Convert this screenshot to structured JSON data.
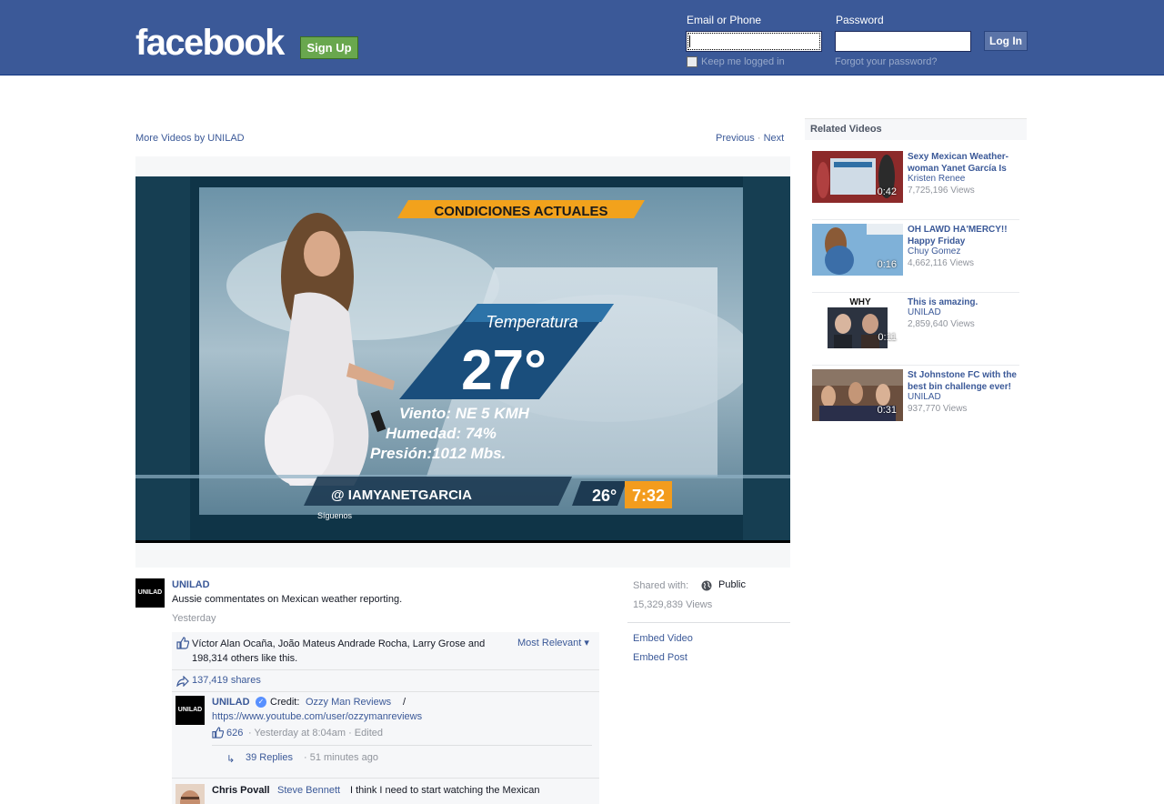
{
  "header": {
    "logo": "facebook",
    "signup_label": "Sign Up",
    "email_label": "Email or Phone",
    "password_label": "Password",
    "login_label": "Log In",
    "keep_logged_in": "Keep me logged in",
    "forgot_password": "Forgot your password?"
  },
  "nav": {
    "more_videos": "More Videos by UNILAD",
    "previous": "Previous",
    "separator": " · ",
    "next": "Next"
  },
  "video": {
    "banner": "CONDICIONES ACTUALES",
    "temp_label": "Temperatura",
    "temp_value": "27°",
    "wind": "Viento: NE 5 KMH",
    "humidity": "Humedad: 74%",
    "pressure": "Presión:1012 Mbs.",
    "handle": "@ IAMYANETGARCIA",
    "follow": "Síguenos",
    "ticker_temp": "26°",
    "ticker_time": "7:32"
  },
  "post": {
    "avatar_text": "UNILAD",
    "page_name": "UNILAD",
    "text": "Aussie commentates on Mexican weather reporting.",
    "time": "Yesterday",
    "likes_text": "Víctor Alan Ocaña, João Mateus Andrade Rocha, Larry Grose and 198,314 others like this.",
    "most_relevant": "Most Relevant ▾",
    "shares": "137,419 shares"
  },
  "comments": [
    {
      "avatar_text": "UNILAD",
      "author": "UNILAD",
      "verified": "✓",
      "credit_prefix": "Credit:",
      "credit_link": "Ozzy Man Reviews",
      "slash": "/",
      "url": "https://www.youtube.com/user/ozzymanreviews",
      "likes": "626",
      "meta": "· Yesterday at 8:04am · Edited",
      "reply_arrow": "↳",
      "replies": "39 Replies",
      "replies_time": "· 51 minutes ago"
    },
    {
      "author": "Chris Povall",
      "mention": "Steve Bennett",
      "text": "I think I need to start watching the Mexican"
    }
  ],
  "meta": {
    "shared_with": "Shared with:",
    "privacy": "Public",
    "views": "15,329,839 Views",
    "embed_video": "Embed Video",
    "embed_post": "Embed Post"
  },
  "related": {
    "title": "Related Videos",
    "items": [
      {
        "title": "Sexy Mexican Weather-woman Yanet García Is",
        "author": "Kristen Renee",
        "views": "7,725,196 Views",
        "duration": "0:42"
      },
      {
        "title": "OH LAWD HA'MERCY!! Happy Friday",
        "author": "Chuy Gomez",
        "views": "4,662,116 Views",
        "duration": "0:16"
      },
      {
        "title": "This is amazing.",
        "author": "UNILAD",
        "views": "2,859,640 Views",
        "duration": "0:11",
        "thumb_text": "WHY"
      },
      {
        "title": "St Johnstone FC with the best bin challenge ever!",
        "author": "UNILAD",
        "views": "937,770 Views",
        "duration": "0:31"
      }
    ]
  },
  "colors": {
    "brand_blue": "#3b5998",
    "signup_green": "#69a74e",
    "ticker_orange": "#f39c1d"
  }
}
